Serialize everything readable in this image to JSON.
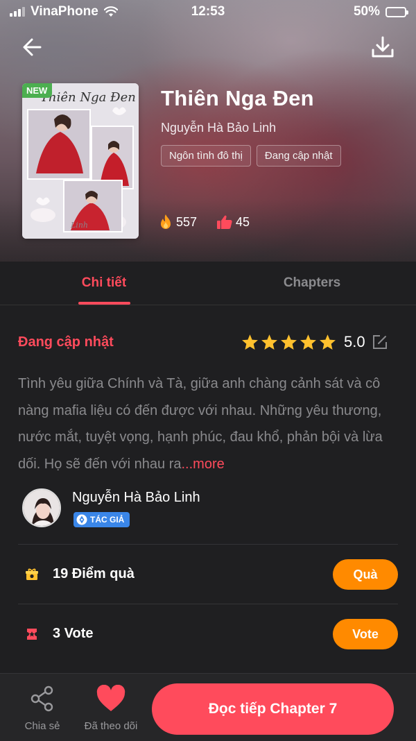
{
  "status_bar": {
    "carrier": "VinaPhone",
    "time": "12:53",
    "battery": "50%",
    "battery_level": 0.5
  },
  "book": {
    "new_badge": "NEW",
    "cover_title": "Thiên Nga Đen",
    "title": "Thiên Nga Đen",
    "author": "Nguyễn Hà Bảo Linh",
    "tags": [
      "Ngôn tình đô thị",
      "Đang cập nhật"
    ],
    "views": "557",
    "likes": "45"
  },
  "tabs": [
    {
      "label": "Chi tiết",
      "active": true
    },
    {
      "label": "Chapters",
      "active": false
    }
  ],
  "detail": {
    "status": "Đang cập nhật",
    "rating_stars": 5,
    "rating": "5.0",
    "description": "Tình yêu giữa Chính và Tà, giữa anh chàng cảnh sát và cô nàng mafia liệu có đến được với nhau. Những yêu thương, nước mắt, tuyệt vọng, hạnh phúc, đau khổ, phản bội và lừa dối. Họ sẽ đến với nhau ra",
    "more": "...more",
    "author_name": "Nguyễn Hà Bảo Linh",
    "author_badge": "TÁC GIẢ"
  },
  "rows": {
    "gift": {
      "label": "19 Điểm quà",
      "button": "Quà"
    },
    "vote": {
      "label": "3 Vote",
      "button": "Vote"
    }
  },
  "bottom_bar": {
    "share_label": "Chia sẻ",
    "follow_label": "Đã theo dõi",
    "read_button": "Đọc tiếp Chapter 7"
  },
  "colors": {
    "accent": "#ff4b5c",
    "orange": "#ff8a00",
    "background": "#1f1f21",
    "star": "#ffc12e",
    "new_badge": "#4caf50",
    "author_badge": "#3a86e8"
  }
}
